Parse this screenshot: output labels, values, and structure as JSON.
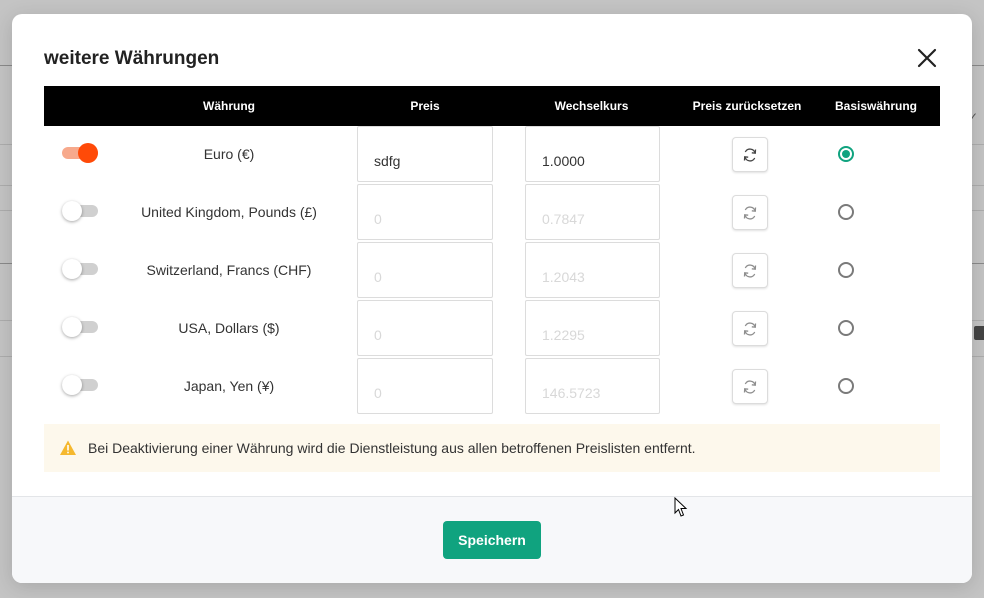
{
  "modal": {
    "title": "weitere Währungen",
    "close_icon": "close-icon"
  },
  "table": {
    "headers": {
      "currency": "Währung",
      "price": "Preis",
      "rate": "Wechselkurs",
      "reset": "Preis zurücksetzen",
      "base": "Basiswährung"
    },
    "rows": [
      {
        "enabled": true,
        "currency": "Euro (€)",
        "price": "sdfg",
        "rate": "1.0000",
        "base": true
      },
      {
        "enabled": false,
        "currency": "United Kingdom, Pounds (£)",
        "price": "0",
        "rate": "0.7847",
        "base": false
      },
      {
        "enabled": false,
        "currency": "Switzerland, Francs (CHF)",
        "price": "0",
        "rate": "1.2043",
        "base": false
      },
      {
        "enabled": false,
        "currency": "USA, Dollars ($)",
        "price": "0",
        "rate": "1.2295",
        "base": false
      },
      {
        "enabled": false,
        "currency": "Japan, Yen (¥)",
        "price": "0",
        "rate": "146.5723",
        "base": false
      }
    ]
  },
  "warning": {
    "icon": "warning-icon",
    "text": "Bei Deaktivierung einer Währung wird die Dienstleistung aus allen betroffenen Preislisten entfernt."
  },
  "footer": {
    "save_label": "Speichern"
  },
  "colors": {
    "accent": "#10a37f",
    "toggle_on": "#ff4a08",
    "header_bg": "#000000",
    "warning_bg": "#fdf8ec"
  }
}
